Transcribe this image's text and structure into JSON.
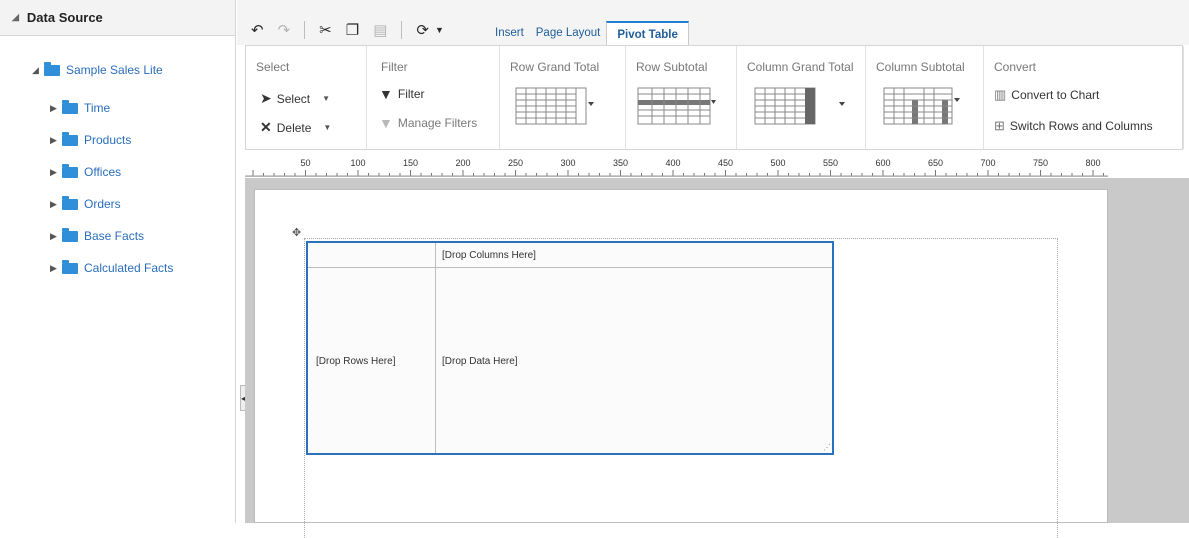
{
  "sidebar": {
    "title": "Data Source",
    "root": "Sample Sales Lite",
    "items": [
      {
        "label": "Time"
      },
      {
        "label": "Products"
      },
      {
        "label": "Offices"
      },
      {
        "label": "Orders"
      },
      {
        "label": "Base Facts"
      },
      {
        "label": "Calculated Facts"
      }
    ]
  },
  "tabs": [
    {
      "label": "Insert"
    },
    {
      "label": "Page Layout"
    },
    {
      "label": "Pivot Table",
      "active": true
    }
  ],
  "ribbon": {
    "select": {
      "title": "Select",
      "select_label": "Select",
      "delete_label": "Delete"
    },
    "filter": {
      "title": "Filter",
      "filter_label": "Filter",
      "manage_label": "Manage Filters"
    },
    "row_grand_total": {
      "title": "Row Grand Total"
    },
    "row_subtotal": {
      "title": "Row Subtotal"
    },
    "column_grand_total": {
      "title": "Column Grand Total"
    },
    "column_subtotal": {
      "title": "Column Subtotal"
    },
    "convert": {
      "title": "Convert",
      "convert_label": "Convert to Chart",
      "switch_label": "Switch Rows and Columns"
    }
  },
  "ruler": {
    "labels": [
      "50",
      "100",
      "150",
      "200",
      "250",
      "300",
      "350",
      "400",
      "450",
      "500",
      "550",
      "600",
      "650",
      "700",
      "750",
      "800"
    ]
  },
  "pivot": {
    "columns_placeholder": "[Drop Columns Here]",
    "rows_placeholder": "[Drop Rows Here]",
    "data_placeholder": "[Drop Data Here]"
  },
  "colors": {
    "accent": "#2a72c0",
    "link": "#2a6ebb",
    "folder": "#2f8fd8"
  }
}
